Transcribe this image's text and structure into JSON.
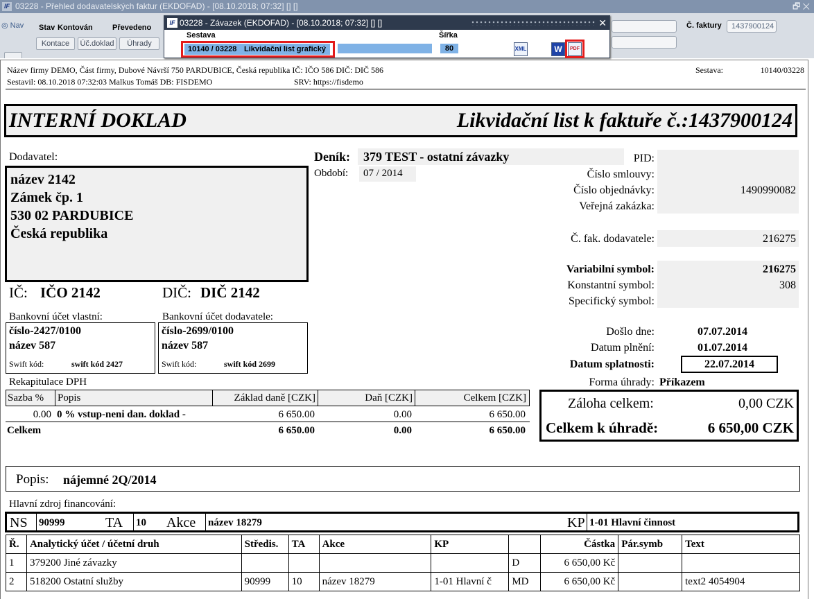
{
  "bg": {
    "title": "03228 - Přehled dodavatelských faktur (EKDOFAD) - [08.10.2018; 07:32] [] []",
    "logo": "IF",
    "win_controls": "🗗 ✕",
    "nav_label": "◎ Nav",
    "stav_label": "Stav",
    "kontovan_label": "Kontován",
    "prevedeno_label": "Převedeno",
    "btn_kontace": "Kontace",
    "btn_ucdoklad": "Úč.doklad",
    "btn_uhrady": "Úhrady",
    "cislo_faktury_label": "Č. faktury",
    "cislo_faktury_value": "1437900124"
  },
  "dialog": {
    "title": "03228 - Závazek (EKDOFAD) - [08.10.2018; 07:32] [] []",
    "logo": "IF",
    "close": "✕",
    "sestava_label": "Sestava",
    "sirka_label": "Šířka",
    "sestava_code": "10140 / 03228",
    "sestava_name": "Likvidační list grafický",
    "sirka_value": "80",
    "icon_xml": "XML",
    "icon_word": "W",
    "icon_pdf": "PDF"
  },
  "header": {
    "line1": "Název firmy DEMO, Část firmy, Dubové Návrší 750 PARDUBICE, Česká republika  IČ: IČO 586  DIČ: DIČ 586",
    "line2_a": "Sestavil: 08.10.2018 07:32:03 Malkus Tomáš  DB: FISDEMO",
    "line2_b": "SRV: https://fisdemo",
    "sestava_label": "Sestava:",
    "sestava_value": "10140/03228"
  },
  "title_left": "INTERNÍ DOKLAD",
  "title_right": "Likvidační list k faktuře č.:1437900124",
  "supplier": {
    "label": "Dodavatel:",
    "lines": [
      "název 2142",
      "Zámek čp. 1",
      "530 02 PARDUBICE",
      "Česká republika"
    ],
    "ic_label": "IČ:",
    "ic_value": "IČO 2142",
    "dic_label": "DIČ:",
    "dic_value": "DIČ 2142"
  },
  "journal": {
    "denik_label": "Deník:",
    "denik_value": "379 TEST - ostatní závazky",
    "obdobi_label": "Období:",
    "obdobi_value": "07 / 2014"
  },
  "right_fields": {
    "pid_label": "PID:",
    "smlouvy_label": "Číslo smlouvy:",
    "objednavky_label": "Číslo objednávky:",
    "objednavky_value": "1490990082",
    "zakazka_label": "Veřejná zakázka:",
    "fak_dod_label": "Č. fak. dodavatele:",
    "fak_dod_value": "216275",
    "vs_label": "Variabilní symbol:",
    "vs_value": "216275",
    "ks_label": "Konstantní symbol:",
    "ks_value": "308",
    "ss_label": "Specifický symbol:"
  },
  "dates": {
    "doslo_label": "Došlo dne:",
    "doslo_value": "07.07.2014",
    "plneni_label": "Datum plnění:",
    "plneni_value": "01.07.2014",
    "splatnost_label": "Datum splatnosti:",
    "splatnost_value": "22.07.2014",
    "forma_label": "Forma úhrady:",
    "forma_value": "Příkazem"
  },
  "bank": {
    "own_label": "Bankovní účet vlastní:",
    "own_number": "číslo-2427/0100",
    "own_name": "název 587",
    "own_swift_label": "Swift kód:",
    "own_swift_value": "swift kód 2427",
    "sup_label": "Bankovní účet dodavatele:",
    "sup_number": "číslo-2699/0100",
    "sup_name": "název 587",
    "sup_swift_label": "Swift kód:",
    "sup_swift_value": "swift kód 2699"
  },
  "vat": {
    "title": "Rekapitulace DPH",
    "headers": [
      "Sazba %",
      "Popis",
      "Základ daně [CZK]",
      "Daň [CZK]",
      "Celkem [CZK]"
    ],
    "row": [
      "0.00",
      "0 % vstup-neni dan. doklad -",
      "6 650.00",
      "0.00",
      "6 650.00"
    ],
    "total_label": "Celkem",
    "total": [
      "6 650.00",
      "0.00",
      "6 650.00"
    ]
  },
  "totals": {
    "zaloha_label": "Záloha celkem:",
    "zaloha_value": "0,00 CZK",
    "celkem_label": "Celkem k úhradě:",
    "celkem_value": "6 650,00 CZK"
  },
  "popis": {
    "label": "Popis:",
    "value": "nájemné 2Q/2014"
  },
  "funding": {
    "label": "Hlavní zdroj financování:",
    "ns_label": "NS",
    "ns_value": "90999",
    "ta_label": "TA",
    "ta_value": "10",
    "akce_label": "Akce",
    "akce_value": "název 18279",
    "kp_label": "KP",
    "kp_value": "1-01 Hlavní činnost"
  },
  "entries": {
    "headers": [
      "Ř.",
      "Analytický účet / účetní druh",
      "Středis.",
      "TA",
      "Akce",
      "KP",
      "",
      "Částka",
      "Pár.symb",
      "Text"
    ],
    "rows": [
      [
        "1",
        "379200 Jiné závazky",
        "",
        "",
        "",
        "",
        "D",
        "6 650,00 Kč",
        "",
        ""
      ],
      [
        "2",
        "518200 Ostatní služby",
        "90999",
        "10",
        "název 18279",
        "1-01 Hlavní č",
        "MD",
        "6 650,00 Kč",
        "",
        "text2 4054904"
      ]
    ]
  }
}
